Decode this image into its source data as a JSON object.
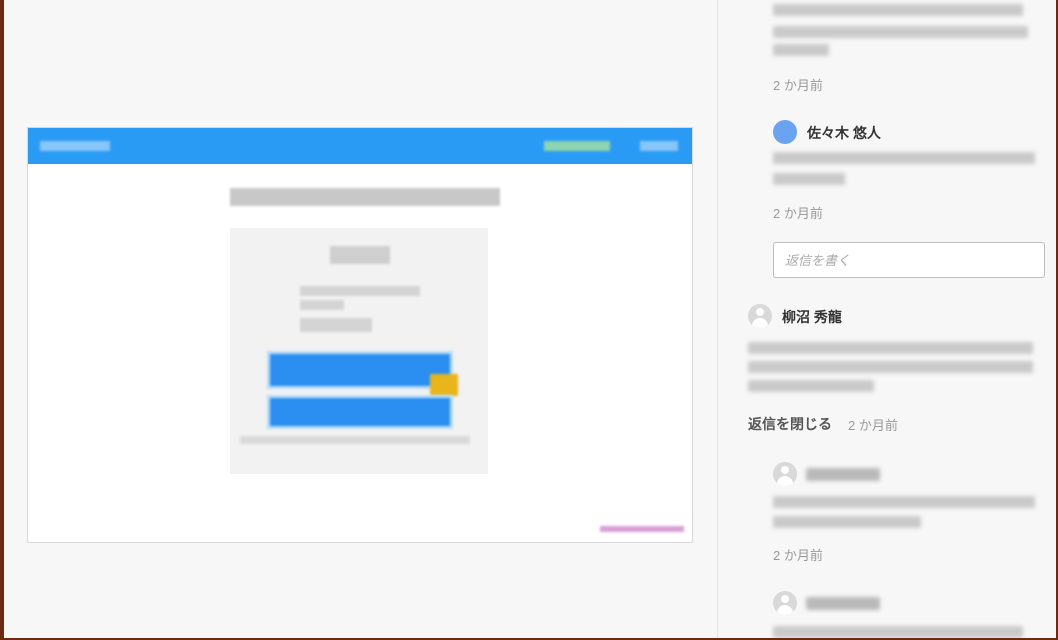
{
  "preview": {},
  "comments": {
    "c0": {
      "time": "2 か月前"
    },
    "c1": {
      "author": "佐々木 悠人",
      "time": "2 か月前"
    },
    "reply": {
      "placeholder": "返信を書く"
    },
    "c2": {
      "author": "柳沼 秀龍",
      "close_replies": "返信を閉じる",
      "time": "2 か月前"
    },
    "r1": {
      "time": "2 か月前"
    }
  },
  "colors": {
    "header_blue": "#2a9bf5",
    "avatar_blue": "#6aa3f2",
    "highlight_yellow": "#e8b51a"
  }
}
